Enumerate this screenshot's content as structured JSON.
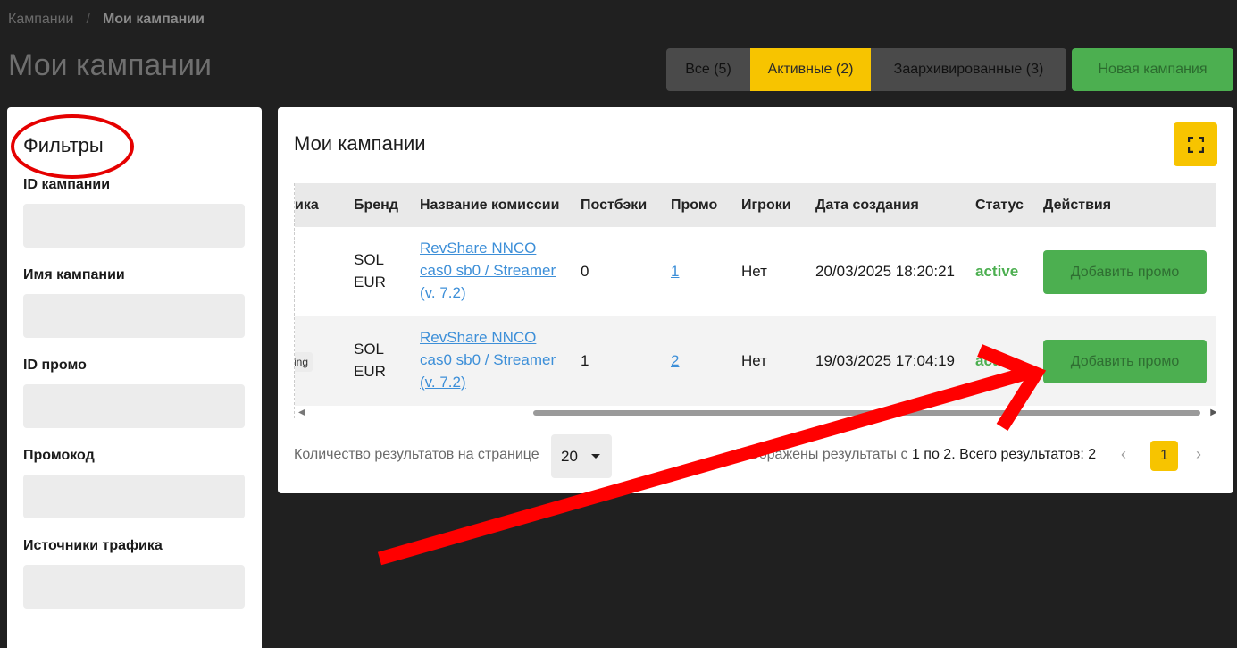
{
  "breadcrumb": {
    "parent": "Кампании",
    "separator": "/",
    "current": "Мои кампании"
  },
  "page_title": "Мои кампании",
  "filter_tabs": [
    {
      "label": "Все (5)"
    },
    {
      "label": "Активные (2)"
    },
    {
      "label": "Заархивированные (3)"
    }
  ],
  "new_campaign_label": "Новая кампания",
  "filters": {
    "title": "Фильтры",
    "fields": [
      {
        "label": "ID кампании",
        "value": ""
      },
      {
        "label": "Имя кампании",
        "value": ""
      },
      {
        "label": "ID промо",
        "value": ""
      },
      {
        "label": "Промокод",
        "value": ""
      },
      {
        "label": "Источники трафика",
        "value": ""
      }
    ]
  },
  "card": {
    "title": "Мои кампании",
    "fullscreen_icon": "expand-icon"
  },
  "table": {
    "headers": [
      "фика",
      "Бренд",
      "Название комиссии",
      "Постбэки",
      "Промо",
      "Игроки",
      "Дата создания",
      "Статус",
      "Действия"
    ],
    "rows": [
      {
        "traffic_tag": "",
        "brand_line1": "SOL",
        "brand_line2": "EUR",
        "commission_line1": "RevShare NNCO",
        "commission_line2": "cas0 sb0 / Streamer",
        "commission_line3": "(v. 7.2)",
        "postbacks": "0",
        "promo": "1",
        "players": "Нет",
        "created": "20/03/2025 18:20:21",
        "status": "active",
        "action": "Добавить промо"
      },
      {
        "traffic_tag": "ing",
        "brand_line1": "SOL",
        "brand_line2": "EUR",
        "commission_line1": "RevShare NNCO",
        "commission_line2": "cas0 sb0 / Streamer",
        "commission_line3": "(v. 7.2)",
        "postbacks": "1",
        "promo": "2",
        "players": "Нет",
        "created": "19/03/2025 17:04:19",
        "status": "active",
        "action": "Добавить промо"
      }
    ]
  },
  "pagination": {
    "per_page_label": "Количество результатов на странице",
    "per_page_value": "20",
    "results_prefix": "Отображены результаты с",
    "results_range": "1 по 2.",
    "results_total_label": "Всего результатов: 2",
    "current_page": "1"
  },
  "colors": {
    "accent": "#f7c400",
    "success": "#4caf50",
    "annotation": "#e50000"
  }
}
